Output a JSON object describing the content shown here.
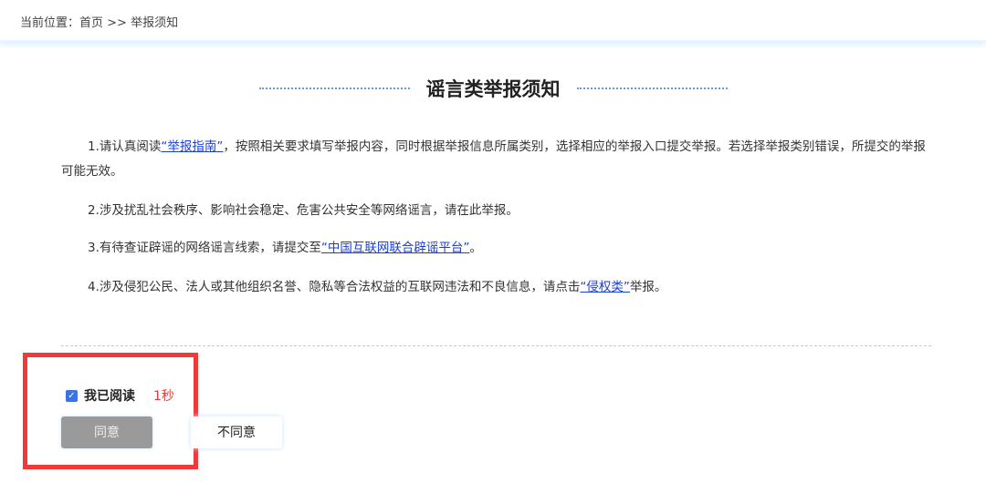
{
  "breadcrumb": {
    "label": "当前位置：",
    "home": "首页",
    "sep": " >> ",
    "current": "举报须知"
  },
  "title": "谣言类举报须知",
  "items": [
    {
      "pre": "1.请认真阅读",
      "link": "“举报指南”",
      "post": "，按照相关要求填写举报内容，同时根据举报信息所属类别，选择相应的举报入口提交举报。若选择举报类别错误，所提交的举报可能无效。"
    },
    {
      "pre": "2.涉及扰乱社会秩序、影响社会稳定、危害公共安全等网络谣言，请在此举报。"
    },
    {
      "pre": "3.有待查证辟谣的网络谣言线索，请提交至",
      "link": "“中国互联网联合辟谣平台”",
      "post": "。"
    },
    {
      "pre": "4.涉及侵犯公民、法人或其他组织名誉、隐私等合法权益的互联网违法和不良信息，请点击",
      "link": "“侵权类”",
      "post": "举报。"
    }
  ],
  "confirm": {
    "checked": true,
    "label": "我已阅读",
    "countdown": "1秒"
  },
  "buttons": {
    "agree": "同意",
    "disagree": "不同意"
  },
  "colors": {
    "link": "#1a3fd6",
    "countdown": "#e53935",
    "highlight": "#f03a3a",
    "checkbox": "#3b73e0"
  }
}
